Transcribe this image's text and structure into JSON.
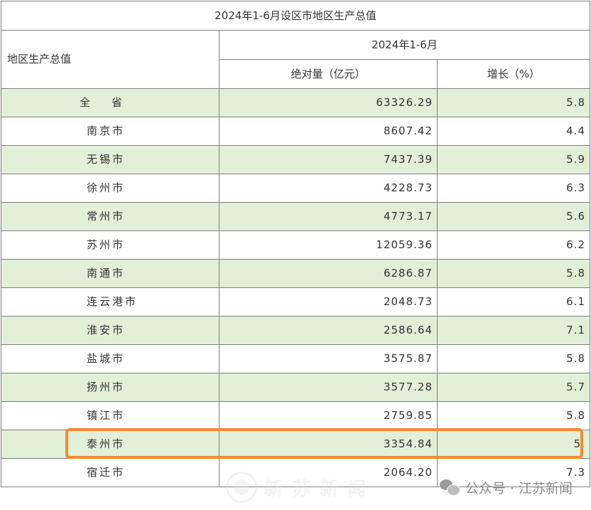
{
  "table": {
    "title": "2024年1-6月设区市地区生产总值",
    "col_region": "地区生产总值",
    "col_period": "2024年1-6月",
    "col_value": "绝对量（亿元）",
    "col_growth": "增长（%）",
    "rows": [
      {
        "name": "全　　省",
        "value": "63326.29",
        "growth": "5.8"
      },
      {
        "name": "南京市",
        "value": "8607.42",
        "growth": "4.4"
      },
      {
        "name": "无锡市",
        "value": "7437.39",
        "growth": "5.9"
      },
      {
        "name": "徐州市",
        "value": "4228.73",
        "growth": "6.3"
      },
      {
        "name": "常州市",
        "value": "4773.17",
        "growth": "5.6"
      },
      {
        "name": "苏州市",
        "value": "12059.36",
        "growth": "6.2"
      },
      {
        "name": "南通市",
        "value": "6286.87",
        "growth": "5.8"
      },
      {
        "name": "连云港市",
        "value": "2048.73",
        "growth": "6.1"
      },
      {
        "name": "淮安市",
        "value": "2586.64",
        "growth": "7.1"
      },
      {
        "name": "盐城市",
        "value": "3575.87",
        "growth": "5.8"
      },
      {
        "name": "扬州市",
        "value": "3577.28",
        "growth": "5.7"
      },
      {
        "name": "镇江市",
        "value": "2759.85",
        "growth": "5.8"
      },
      {
        "name": "泰州市",
        "value": "3354.84",
        "growth": "5."
      },
      {
        "name": "宿迁市",
        "value": "2064.20",
        "growth": "7.3"
      }
    ]
  },
  "watermark": {
    "left_text": "新 苏 新 闻",
    "right_text": "公众号 · 江苏新闻"
  },
  "colors": {
    "row_shade": "#e2efd9",
    "highlight": "#f58a32",
    "border": "#7f7f7f"
  }
}
